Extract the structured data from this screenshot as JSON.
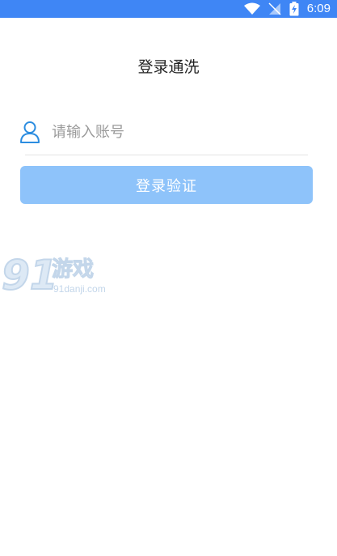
{
  "status_bar": {
    "time": "6:09",
    "icons": [
      "wifi-icon",
      "signal-icon",
      "battery-charging-icon"
    ],
    "background": "#3f86f5"
  },
  "page": {
    "title": "登录通洗"
  },
  "login_form": {
    "account_field": {
      "icon": "user-icon",
      "value": "",
      "placeholder": "请输入账号"
    },
    "submit_label": "登录验证",
    "button_color": "#8ec3fa"
  },
  "watermark": {
    "number": "91",
    "name": "游戏",
    "url": "91danji.com"
  }
}
